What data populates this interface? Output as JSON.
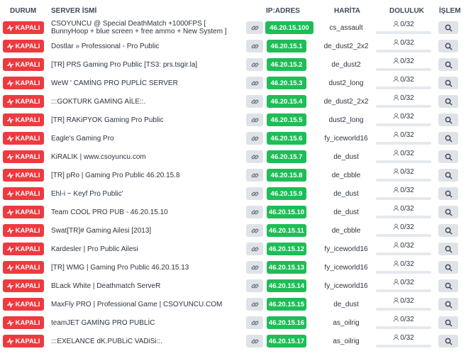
{
  "headers": {
    "status": "DURUM",
    "name": "SERVER İSMİ",
    "ip": "IP:ADRES",
    "map": "HARİTA",
    "occupancy": "DOLULUK",
    "action": "İŞLEM"
  },
  "status_label": "KAPALI",
  "colors": {
    "closed": "#ee3a3f",
    "ip": "#1ebd57",
    "header": "#3e4a59"
  },
  "icons": {
    "status": "pulse-icon",
    "copy": "link-icon",
    "players": "user-icon",
    "action": "search-icon"
  },
  "rows": [
    {
      "name": "CSOYUNCU @ Special DeathMatch +1000FPS [ BunnyHoop + blue screen + free ammo + New System ]",
      "ip": "46.20.15.100",
      "map": "cs_assault",
      "players": "0/32"
    },
    {
      "name": "Dostlar » Professional - Pro Public",
      "ip": "46.20.15.1",
      "map": "de_dust2_2x2",
      "players": "0/32"
    },
    {
      "name": "[TR] PRS Gaming Pro Public [TS3: prs.tsgir.la]",
      "ip": "46.20.15.2",
      "map": "de_dust2",
      "players": "0/32"
    },
    {
      "name": "WeW ' CAMİNG PRO PUPLİC SERVER",
      "ip": "46.20.15.3",
      "map": "dust2_long",
      "players": "0/32"
    },
    {
      "name": ":::GOKTURK GAMİNG AİLE::.",
      "ip": "46.20.15.4",
      "map": "de_dust2_2x2",
      "players": "0/32"
    },
    {
      "name": "[TR] RAKiPYOK Gaming Pro Public",
      "ip": "46.20.15.5",
      "map": "dust2_long",
      "players": "0/32"
    },
    {
      "name": "Eagle's Gaming Pro",
      "ip": "46.20.15.6",
      "map": "fy_iceworld16",
      "players": "0/32"
    },
    {
      "name": "KiRALIK | www.csoyuncu.com",
      "ip": "46.20.15.7",
      "map": "de_dust",
      "players": "0/32"
    },
    {
      "name": "[TR] pRo | Gaming Pro Public 46.20.15.8",
      "ip": "46.20.15.8",
      "map": "de_cbble",
      "players": "0/32"
    },
    {
      "name": "Ehl-i ~ Keyf Pro Public'",
      "ip": "46.20.15.9",
      "map": "de_dust",
      "players": "0/32"
    },
    {
      "name": "Team COOL PRO PUB - 46.20.15.10",
      "ip": "46.20.15.10",
      "map": "de_dust",
      "players": "0/32"
    },
    {
      "name": "Swat[TR]# Gaming Ailesi [2013]",
      "ip": "46.20.15.11",
      "map": "de_cbble",
      "players": "0/32"
    },
    {
      "name": "Kardesler | Pro Public Ailesi",
      "ip": "46.20.15.12",
      "map": "fy_iceworld16",
      "players": "0/32"
    },
    {
      "name": "[TR] WMG | Gaming Pro Public 46.20.15.13",
      "ip": "46.20.15.13",
      "map": "fy_iceworld16",
      "players": "0/32"
    },
    {
      "name": "BLack White | Deathmatch ServeR",
      "ip": "46.20.15.14",
      "map": "fy_iceworld16",
      "players": "0/32"
    },
    {
      "name": "MaxFly PRO | Professional Game | CSOYUNCU.COM",
      "ip": "46.20.15.15",
      "map": "de_dust",
      "players": "0/32"
    },
    {
      "name": "teamJET GAMİNG PRO PUBLİC",
      "ip": "46.20.15.16",
      "map": "as_oilrig",
      "players": "0/32"
    },
    {
      "name": ":::EXELANCE dK.PUBLiC VADiSi::.",
      "ip": "46.20.15.17",
      "map": "as_oilrig",
      "players": "0/32"
    }
  ]
}
